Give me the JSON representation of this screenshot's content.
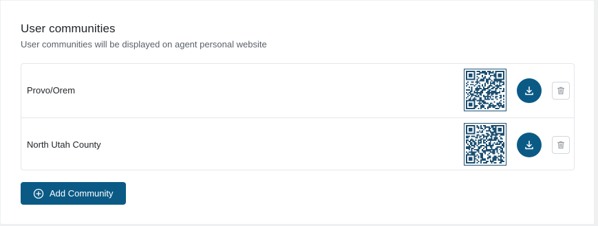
{
  "section": {
    "title": "User communities",
    "subtitle": "User communities will be displayed on agent personal website"
  },
  "communities": [
    {
      "name": "Provo/Orem"
    },
    {
      "name": "North Utah County"
    }
  ],
  "icons": {
    "qr": "qr-code-icon",
    "download": "download-icon",
    "delete": "trash-icon",
    "add": "plus-circle-icon"
  },
  "add_button": {
    "label": "Add Community"
  },
  "colors": {
    "accent": "#0b5a86",
    "qr_dark": "#1b4e70",
    "border": "#e3e6ea"
  }
}
